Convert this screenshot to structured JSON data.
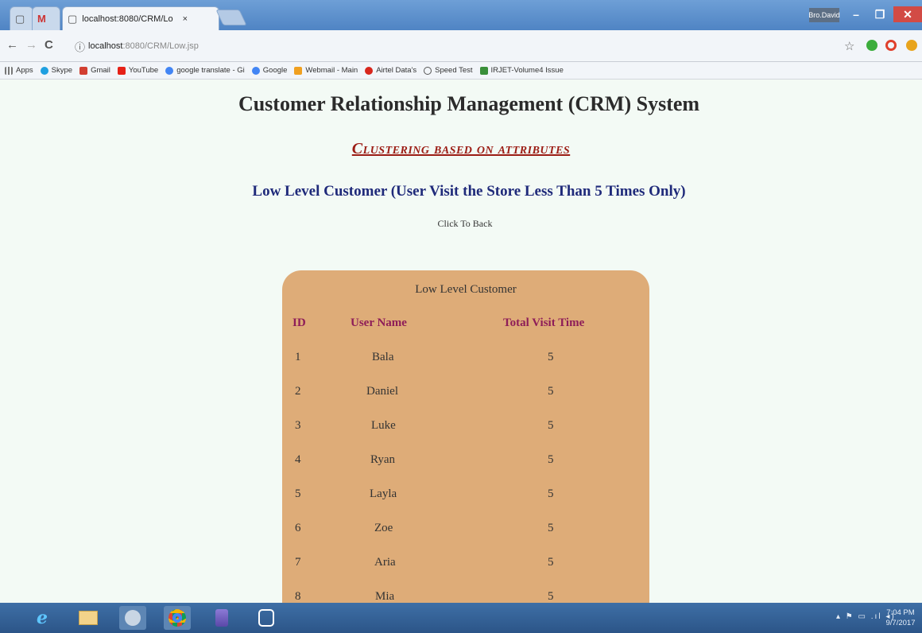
{
  "browser": {
    "tab_title": "localhost:8080/CRM/Lo",
    "tab_close": "×",
    "profile_name": "Bro.David",
    "window_buttons": {
      "minimize": "–",
      "restore": "❐",
      "close": "✕"
    },
    "nav": {
      "back": "←",
      "forward": "→",
      "reload": "C",
      "info": "ⓘ"
    },
    "url_host": "localhost",
    "url_path": ":8080/CRM/Low.jsp",
    "star": "☆",
    "extension_colors": [
      "#3cad3c",
      "#e0402c",
      "#e8a41c"
    ]
  },
  "bookmarks": [
    {
      "label": "Apps",
      "icon": "apps-icon",
      "color": "#6a6a6a"
    },
    {
      "label": "Skype",
      "icon": "skype-icon",
      "color": "#1fa0e0"
    },
    {
      "label": "Gmail",
      "icon": "gmail-icon",
      "color": "#d23f31"
    },
    {
      "label": "YouTube",
      "icon": "youtube-icon",
      "color": "#e62117"
    },
    {
      "label": "google translate - Gi",
      "icon": "google-icon",
      "color": "#4285f4"
    },
    {
      "label": "Google",
      "icon": "google-icon",
      "color": "#4285f4"
    },
    {
      "label": "Webmail - Main",
      "icon": "webmail-icon",
      "color": "#f0a020"
    },
    {
      "label": "Airtel Data's",
      "icon": "airtel-icon",
      "color": "#d8261c"
    },
    {
      "label": "Speed Test",
      "icon": "speedtest-icon",
      "color": "#555555"
    },
    {
      "label": "IRJET-Volume4 Issue",
      "icon": "irjet-icon",
      "color": "#3a8f3a"
    }
  ],
  "page": {
    "title": "Customer Relationship Management (CRM) System",
    "subtitle": "Clustering based on attributes",
    "heading": "Low Level Customer (User Visit the Store Less Than 5 Times Only)",
    "back_link": "Click To Back"
  },
  "table": {
    "caption": "Low Level Customer",
    "columns": [
      "ID",
      "User Name",
      "Total Visit Time"
    ],
    "rows": [
      [
        "1",
        "Bala",
        "5"
      ],
      [
        "2",
        "Daniel",
        "5"
      ],
      [
        "3",
        "Luke",
        "5"
      ],
      [
        "4",
        "Ryan",
        "5"
      ],
      [
        "5",
        "Layla",
        "5"
      ],
      [
        "6",
        "Zoe",
        "5"
      ],
      [
        "7",
        "Aria",
        "5"
      ],
      [
        "8",
        "Mia",
        "5"
      ]
    ]
  },
  "taskbar": {
    "apps": [
      "internet-explorer-icon",
      "file-explorer-icon",
      "app-icon",
      "chrome-icon",
      "app-icon",
      "app-icon"
    ],
    "tray": "▴ ⚑ ▭ .ıl ◂)",
    "time": "7:04 PM",
    "date": "9/7/2017"
  }
}
